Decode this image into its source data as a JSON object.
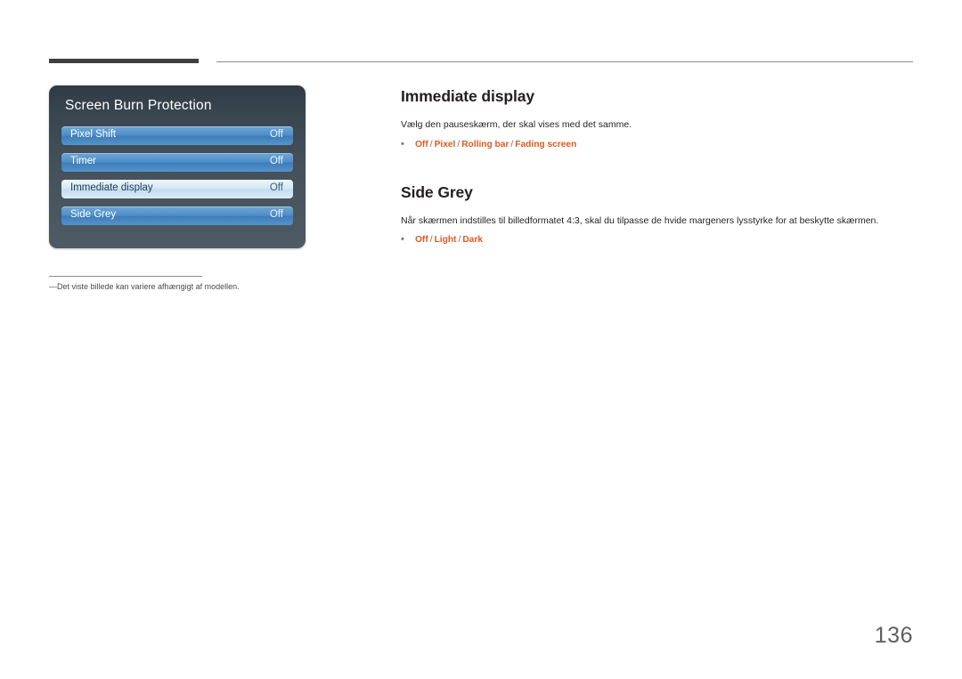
{
  "osd": {
    "title": "Screen Burn Protection",
    "rows": [
      {
        "label": "Pixel Shift",
        "value": "Off",
        "selected": false
      },
      {
        "label": "Timer",
        "value": "Off",
        "selected": false
      },
      {
        "label": "Immediate display",
        "value": "Off",
        "selected": true
      },
      {
        "label": "Side Grey",
        "value": "Off",
        "selected": false
      }
    ]
  },
  "footnote": {
    "dash": "―",
    "text": "Det viste billede kan variere afhængigt af modellen."
  },
  "sections": [
    {
      "heading": "Immediate display",
      "description": "Vælg den pauseskærm, der skal vises med det samme.",
      "options": [
        "Off",
        "Pixel",
        "Rolling bar",
        "Fading screen"
      ]
    },
    {
      "heading": "Side Grey",
      "description": "Når skærmen indstilles til billedformatet 4:3, skal du tilpasse de hvide margeners lysstyrke for at beskytte skærmen.",
      "options": [
        "Off",
        "Light",
        "Dark"
      ]
    }
  ],
  "page_number": "136",
  "bullet_glyph": "•",
  "separator": "/"
}
